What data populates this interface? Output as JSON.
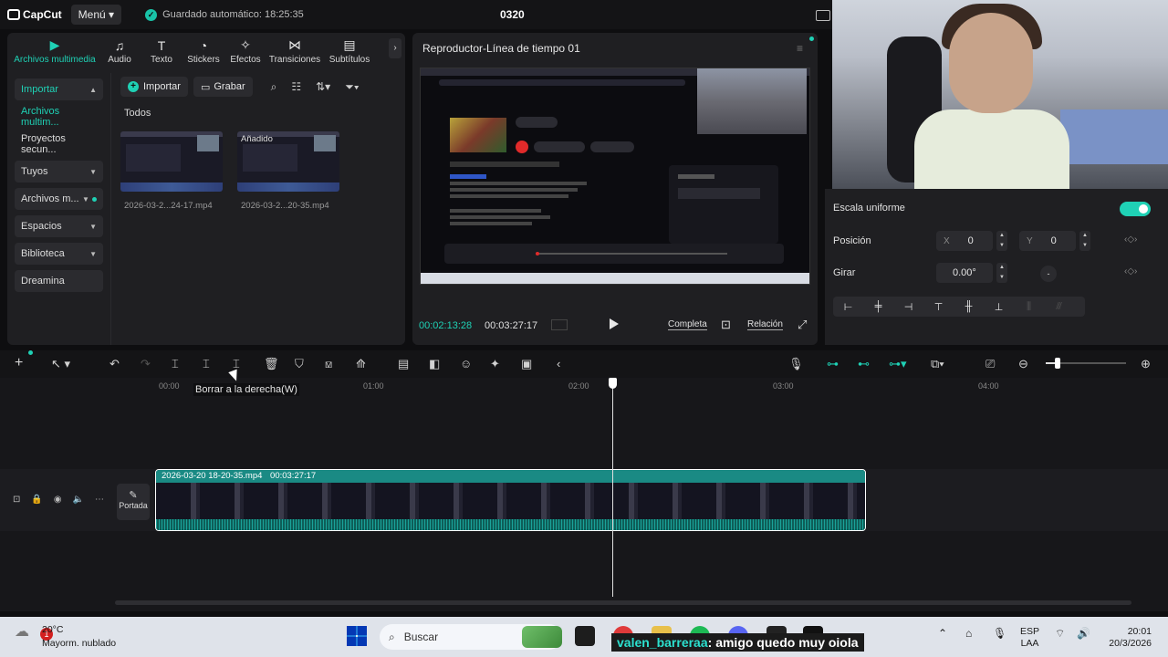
{
  "app": {
    "brand": "CapCut",
    "menu_label": "Menú",
    "autosave": "Guardado automático: 18:25:35",
    "project_title": "0320"
  },
  "media_tabs": [
    {
      "label": "Archivos multimedia",
      "icon": "play-icon",
      "active": true
    },
    {
      "label": "Audio",
      "icon": "audio-icon"
    },
    {
      "label": "Texto",
      "icon": "text-icon"
    },
    {
      "label": "Stickers",
      "icon": "sticker-icon"
    },
    {
      "label": "Efectos",
      "icon": "effects-icon"
    },
    {
      "label": "Transiciones",
      "icon": "transitions-icon"
    },
    {
      "label": "Subtítulos",
      "icon": "subtitles-icon"
    }
  ],
  "sidebar": {
    "items": [
      {
        "label": "Importar"
      },
      {
        "label": "Archivos multim..."
      },
      {
        "label": "Proyectos secun..."
      },
      {
        "label": "Tuyos"
      },
      {
        "label": "Archivos m..."
      },
      {
        "label": "Espacios"
      },
      {
        "label": "Biblioteca"
      },
      {
        "label": "Dreamina"
      }
    ]
  },
  "media_toolbar": {
    "import_label": "Importar",
    "record_label": "Grabar"
  },
  "media_section": "Todos",
  "media_items": [
    {
      "name": "2026-03-2...24-17.mp4",
      "badge": ""
    },
    {
      "name": "2026-03-2...20-35.mp4",
      "badge": "Añadido"
    }
  ],
  "player": {
    "title": "Reproductor-Línea de tiempo 01",
    "current_time": "00:02:13:28",
    "total_time": "00:03:27:17",
    "full_label": "Completa",
    "ratio_label": "Relación"
  },
  "properties": {
    "uniform_scale_label": "Escala uniforme",
    "uniform_scale_on": true,
    "position_label": "Posición",
    "x_label": "X",
    "x_value": "0",
    "y_label": "Y",
    "y_value": "0",
    "rotate_label": "Girar",
    "rotate_value": "0.00°"
  },
  "timeline": {
    "tooltip": "Borrar a la derecha(W)",
    "ruler": [
      "00:00",
      "01:00",
      "02:00",
      "03:00",
      "04:00"
    ],
    "clip_name": "2026-03-20 18-20-35.mp4",
    "clip_duration": "00:03:27:17",
    "cover_label": "Portada",
    "zoom_level": 0.15
  },
  "taskbar": {
    "temp": "20°C",
    "weather": "Mayorm. nublado",
    "notif_count": "1",
    "search_placeholder": "Buscar",
    "chat_user": "valen_barreraa",
    "chat_message": ": amigo quedo muy oiola",
    "lang": "ESP",
    "lang2": "LAA",
    "time": "20:01",
    "date": "20/3/2026"
  },
  "colors": {
    "accent": "#1fd1b5",
    "clip": "#1a8a84",
    "bg": "#1f1f22"
  }
}
